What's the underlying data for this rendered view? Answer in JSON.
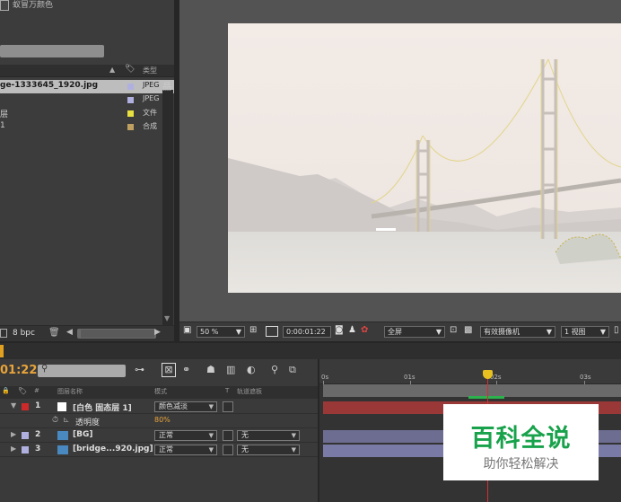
{
  "project": {
    "top_text": "蚁冒万颜色",
    "header_type": "类型",
    "items": [
      {
        "name": "ge-1333645_1920.jpg",
        "type": "JPEG",
        "swatch": "#b0b0e0"
      },
      {
        "name": "层",
        "type": "文件",
        "swatch": "#e8e040"
      },
      {
        "name": "1",
        "type": "合成",
        "swatch": "#c0a060"
      }
    ],
    "extra_type": "JPEG",
    "bpc": "8 bpc"
  },
  "viewer": {
    "zoom": "50 %",
    "timecode": "0:00:01:22",
    "resolution": "全屏",
    "camera": "有效摄像机",
    "views": "1 视图"
  },
  "timeline": {
    "current_time": "01:22",
    "columns": {
      "source_name": "图层名称",
      "mode": "模式",
      "t": "T",
      "trkmat": "轨道遮板"
    },
    "layers": [
      {
        "num": "1",
        "name": "[白色 固态层 1]",
        "mode": "颜色减淡",
        "label": "#cc2a2a",
        "icon_color": "#ffffff"
      },
      {
        "num": "2",
        "name": "[BG]",
        "mode": "正常",
        "trkmat": "无",
        "label": "#b0b0e0",
        "icon_color": "#4a88c0"
      },
      {
        "num": "3",
        "name": "[bridge...920.jpg]",
        "mode": "正常",
        "trkmat": "无",
        "label": "#b0b0e0",
        "icon_color": "#4a88c0"
      }
    ],
    "property": {
      "name": "透明度",
      "value": "80%"
    },
    "ruler": [
      "0s",
      "01s",
      "02s",
      "03s"
    ]
  },
  "watermark": {
    "title": "百科全说",
    "subtitle": "助你轻松解决"
  },
  "colors": {
    "accent": "#e8a43a",
    "playhead": "#d43030",
    "layer1_bar": "#9a3838",
    "layer_bar": "#7a7aa6"
  }
}
